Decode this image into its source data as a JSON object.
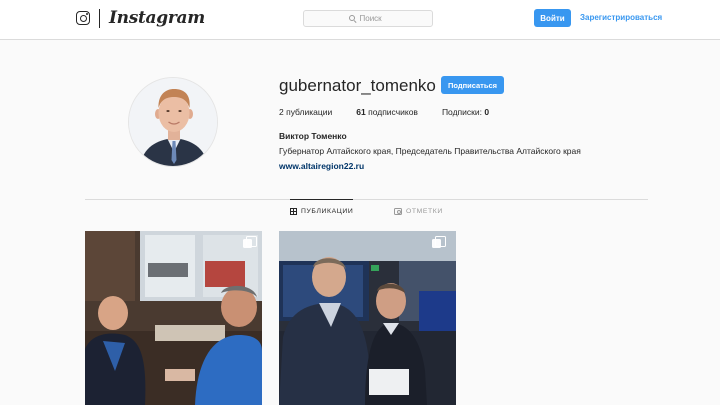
{
  "nav": {
    "brand": "Instagram",
    "search_placeholder": "Поиск",
    "login_label": "Войти",
    "signup_label": "Зарегистрироваться"
  },
  "profile": {
    "username": "gubernator_tomenko",
    "follow_label": "Подписаться",
    "stats": {
      "posts_count": "2",
      "posts_label": "публикации",
      "followers_count": "61",
      "followers_label": "подписчиков",
      "following_label": "Подписки:",
      "following_count": "0"
    },
    "full_name": "Виктор Томенко",
    "bio": "Губернатор Алтайского края, Председатель Правительства Алтайского края",
    "website": "www.altairegion22.ru"
  },
  "tabs": [
    {
      "label": "ПУБЛИКАЦИИ",
      "icon": "grid-icon",
      "active": true
    },
    {
      "label": "ОТМЕТКИ",
      "icon": "tag-icon",
      "active": false
    }
  ],
  "posts": [
    {
      "icon": "multiple-photos-icon"
    },
    {
      "icon": "multiple-photos-icon"
    }
  ],
  "colors": {
    "accent": "#3897f0",
    "link": "#003569",
    "background": "#fafafa",
    "border": "#dbdbdb"
  }
}
